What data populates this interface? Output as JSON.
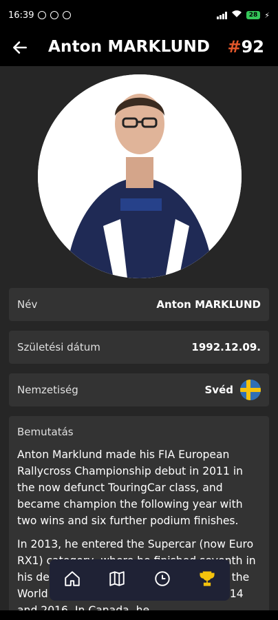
{
  "status": {
    "time": "16:39",
    "battery": "28"
  },
  "header": {
    "title": "Anton MARKLUND",
    "number_hash": "#",
    "number": "92"
  },
  "fields": {
    "name_label": "Név",
    "name_value": "Anton MARKLUND",
    "dob_label": "Születési dátum",
    "dob_value": "1992.12.09.",
    "nationality_label": "Nemzetiség",
    "nationality_value": "Svéd"
  },
  "bio": {
    "label": "Bemutatás",
    "p1": "Anton Marklund made his FIA European Rallycross Championship debut in 2011 in the now defunct TouringCar class, and became champion the following year with two wins and six further podium finishes.",
    "p2": "In 2013, he entered the Supercar (now Euro RX1) category, where he finished seventh in his debut season. He then competed in the World RX for three seasons between 2014 and 2016. In Canada, he"
  },
  "nav": {
    "items": [
      "home-icon",
      "map-icon",
      "clock-icon",
      "trophy-icon"
    ],
    "active": "trophy-icon"
  },
  "colors": {
    "accent": "#e2572b",
    "trophy": "#f4c20d",
    "nav_bg": "#1f2235",
    "card_bg": "#333333"
  }
}
